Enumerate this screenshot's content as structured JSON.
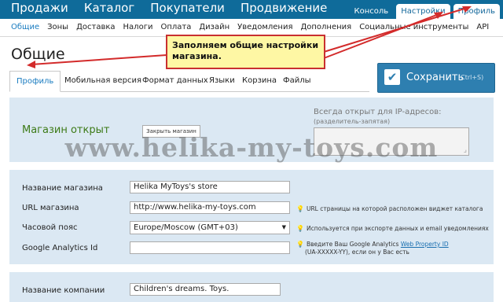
{
  "topnav": {
    "items": [
      "Продажи",
      "Каталог",
      "Покупатели",
      "Продвижение"
    ]
  },
  "topright": {
    "console": "Консоль",
    "settings": "Настройки",
    "profile": "Профиль"
  },
  "subnav": {
    "items": [
      "Общие",
      "Зоны",
      "Доставка",
      "Налоги",
      "Оплата",
      "Дизайн",
      "Уведомления",
      "Дополнения",
      "Социальные инструменты",
      "API"
    ]
  },
  "page": {
    "title": "Общие"
  },
  "tabs": [
    "Профиль",
    "Мобильная версия",
    "Формат данных",
    "Языки",
    "Корзина",
    "Файлы"
  ],
  "save": {
    "label": "Сохранить",
    "shortcut": "(Ctrl+S)"
  },
  "shop": {
    "status": "Магазин открыт",
    "close_button": "Закрыть магазин"
  },
  "ip": {
    "label": "Всегда открыт для IP-адресов:",
    "sub": "(разделитель-запятая)"
  },
  "form": {
    "store_name": {
      "label": "Название магазина",
      "value": "Helika MyToys's store"
    },
    "store_url": {
      "label": "URL магазина",
      "value": "http://www.helika-my-toys.com",
      "hint": "URL страницы на которой расположен виджет каталога"
    },
    "timezone": {
      "label": "Часовой пояс",
      "value": "Europe/Moscow (GMT+03)",
      "hint": "Используется при экспорте данных и email уведомлениях"
    },
    "ga": {
      "label": "Google Analytics Id",
      "value": "",
      "hint_pre": "Введите Ваш Google Analytics ",
      "hint_link": "Web Property ID",
      "hint_post": "(UA-XXXXX-YY), если он у Вас есть"
    },
    "company": {
      "label": "Название компании",
      "value": "Children's dreams. Toys."
    }
  },
  "callout": {
    "text": "Заполняем общие настройки магазина."
  },
  "watermark": "www.helika-my-toys.com",
  "colors": {
    "topbar": "#0f6b9a",
    "accent": "#1a7cc0",
    "panel": "#dbe8f3",
    "callout_bg": "#fef7a4",
    "callout_border": "#c93030"
  },
  "icons": {
    "save": "check-icon",
    "hint": "lightbulb-icon",
    "select": "chevron-down-icon",
    "resize": "resize-grip-icon"
  }
}
